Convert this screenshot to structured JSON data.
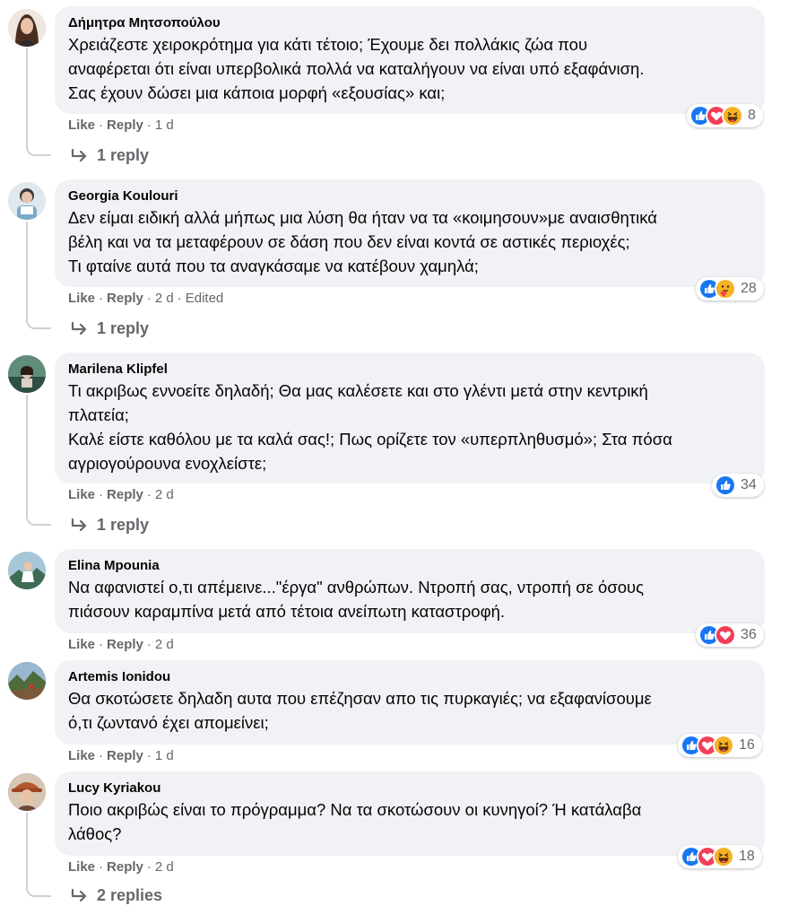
{
  "meta_labels": {
    "like": "Like",
    "reply": "Reply",
    "sep": "·"
  },
  "colors": {
    "like_blue": "#1877f2",
    "love_red": "#f33e58",
    "haha_yellow": "#f7b125",
    "secondary": "#65676b",
    "bubble": "#f0f2f5"
  },
  "comments": [
    {
      "author": "Δήμητρα Μητσοπούλου",
      "text": "Χρειάζεστε χειροκρότημα για κάτι τέτοιο; Έχουμε δει πολλάκις ζώα που\nαναφέρεται ότι είναι υπερβολικά πολλά να καταλήγουν να είναι υπό εξαφάνιση.\nΣας έχουν δώσει μια κάποια μορφή «εξουσίας» και;",
      "time": "1 d",
      "edited": "",
      "reaction_icons": [
        "like-icon",
        "love-icon",
        "haha-icon"
      ],
      "reaction_count": "8",
      "replies": "1 reply"
    },
    {
      "author": "Georgia Koulouri",
      "text": "Δεν είμαι ειδική αλλά μήπως μια λύση θα ήταν να τα «κοιμησουν»με αναισθητικά\nβέλη και να τα μεταφέρουν σε δάση που δεν είναι κοντά σε αστικές περιοχές;\nΤι φταίνε αυτά που τα αναγκάσαμε να κατέβουν χαμηλά;",
      "time": "2 d",
      "edited": "Edited",
      "reaction_icons": [
        "like-icon",
        "care-icon"
      ],
      "reaction_count": "28",
      "replies": "1 reply"
    },
    {
      "author": "Marilena Klipfel",
      "text": "Τι ακριβως εννοείτε δηλαδή; Θα μας καλέσετε και στο γλέντι μετά στην κεντρική\nπλατεία;\nΚαλέ είστε καθόλου με τα καλά σας!; Πως ορίζετε τον «υπερπληθυσμό»; Στα πόσα\nαγριογούρουνα ενοχλείστε;",
      "time": "2 d",
      "edited": "",
      "reaction_icons": [
        "like-icon"
      ],
      "reaction_count": "34",
      "replies": "1 reply"
    },
    {
      "author": "Elina Mpounia",
      "text": "Να αφανιστεί ο,τι απέμεινε...\"έργα\" ανθρώπων. Ντροπή σας, ντροπή σε όσους\nπιάσουν καραμπίνα μετά από τέτοια ανείπωτη καταστροφή.",
      "time": "2 d",
      "edited": "",
      "reaction_icons": [
        "like-icon",
        "love-icon"
      ],
      "reaction_count": "36",
      "replies": ""
    },
    {
      "author": "Artemis Ionidou",
      "text": "Θα σκοτώσετε δηλαδη αυτα που επέζησαν απο τις πυρκαγιές; να εξαφανίσουμε\nό,τι ζωντανό έχει απομείνει;",
      "time": "1 d",
      "edited": "",
      "reaction_icons": [
        "like-icon",
        "love-icon",
        "haha-icon"
      ],
      "reaction_count": "16",
      "replies": ""
    },
    {
      "author": "Lucy Kyriakou",
      "text": "Ποιο ακριβώς είναι το πρόγραμμα? Να τα σκοτώσουν οι κυνηγοί? Ή κατάλαβα\nλάθος?",
      "time": "2 d",
      "edited": "",
      "reaction_icons": [
        "like-icon",
        "love-icon",
        "haha-icon"
      ],
      "reaction_count": "18",
      "replies": "2 replies"
    }
  ]
}
